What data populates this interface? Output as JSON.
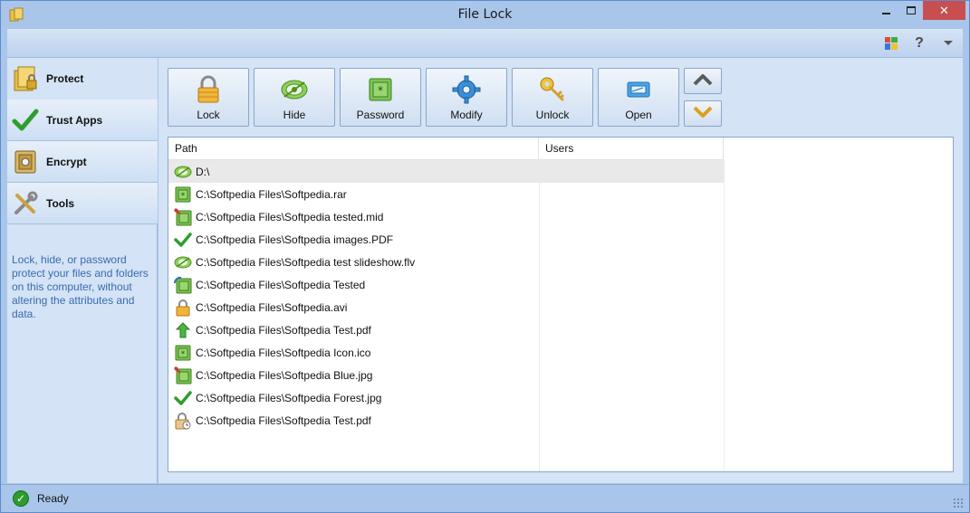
{
  "window": {
    "title": "File Lock"
  },
  "sidebar": {
    "items": [
      {
        "label": "Protect",
        "icon": "folder-lock-icon"
      },
      {
        "label": "Trust Apps",
        "icon": "checkmark-icon"
      },
      {
        "label": "Encrypt",
        "icon": "safe-icon"
      },
      {
        "label": "Tools",
        "icon": "tools-icon"
      }
    ],
    "description": "Lock, hide, or password protect your files and folders on this computer, without altering the attributes and data."
  },
  "toolbar": {
    "buttons": [
      {
        "label": "Lock",
        "icon": "padlock-icon"
      },
      {
        "label": "Hide",
        "icon": "eye-icon"
      },
      {
        "label": "Password",
        "icon": "password-icon"
      },
      {
        "label": "Modify",
        "icon": "gear-icon"
      },
      {
        "label": "Unlock",
        "icon": "key-icon"
      },
      {
        "label": "Open",
        "icon": "open-window-icon"
      }
    ],
    "move_up": "move-up-icon",
    "move_down": "move-down-icon"
  },
  "list": {
    "columns": [
      "Path",
      "Users"
    ],
    "rows": [
      {
        "path": "D:\\",
        "icon": "hidden-icon",
        "users": ""
      },
      {
        "path": "C:\\Softpedia Files\\Softpedia.rar",
        "icon": "password-icon",
        "users": ""
      },
      {
        "path": "C:\\Softpedia Files\\Softpedia tested.mid",
        "icon": "password-pin-icon",
        "users": ""
      },
      {
        "path": "C:\\Softpedia Files\\Softpedia images.PDF",
        "icon": "checkmark-icon",
        "users": ""
      },
      {
        "path": "C:\\Softpedia Files\\Softpedia test slideshow.flv",
        "icon": "hidden-icon",
        "users": ""
      },
      {
        "path": "C:\\Softpedia Files\\Softpedia Tested",
        "icon": "password-refresh-icon",
        "users": ""
      },
      {
        "path": "C:\\Softpedia Files\\Softpedia.avi",
        "icon": "padlock-icon",
        "users": ""
      },
      {
        "path": "C:\\Softpedia Files\\Softpedia Test.pdf",
        "icon": "green-arrow-icon",
        "users": ""
      },
      {
        "path": "C:\\Softpedia Files\\Softpedia Icon.ico",
        "icon": "password-icon",
        "users": ""
      },
      {
        "path": "C:\\Softpedia Files\\Softpedia Blue.jpg",
        "icon": "password-pin-icon",
        "users": ""
      },
      {
        "path": "C:\\Softpedia Files\\Softpedia Forest.jpg",
        "icon": "checkmark-icon",
        "users": ""
      },
      {
        "path": "C:\\Softpedia Files\\Softpedia Test.pdf",
        "icon": "padlock-clock-icon",
        "users": ""
      }
    ]
  },
  "status": {
    "text": "Ready",
    "icon": "ready-check-icon"
  },
  "colors": {
    "accent": "#a9c6ea",
    "panel": "#d4e3f5",
    "close": "#c74f50"
  }
}
